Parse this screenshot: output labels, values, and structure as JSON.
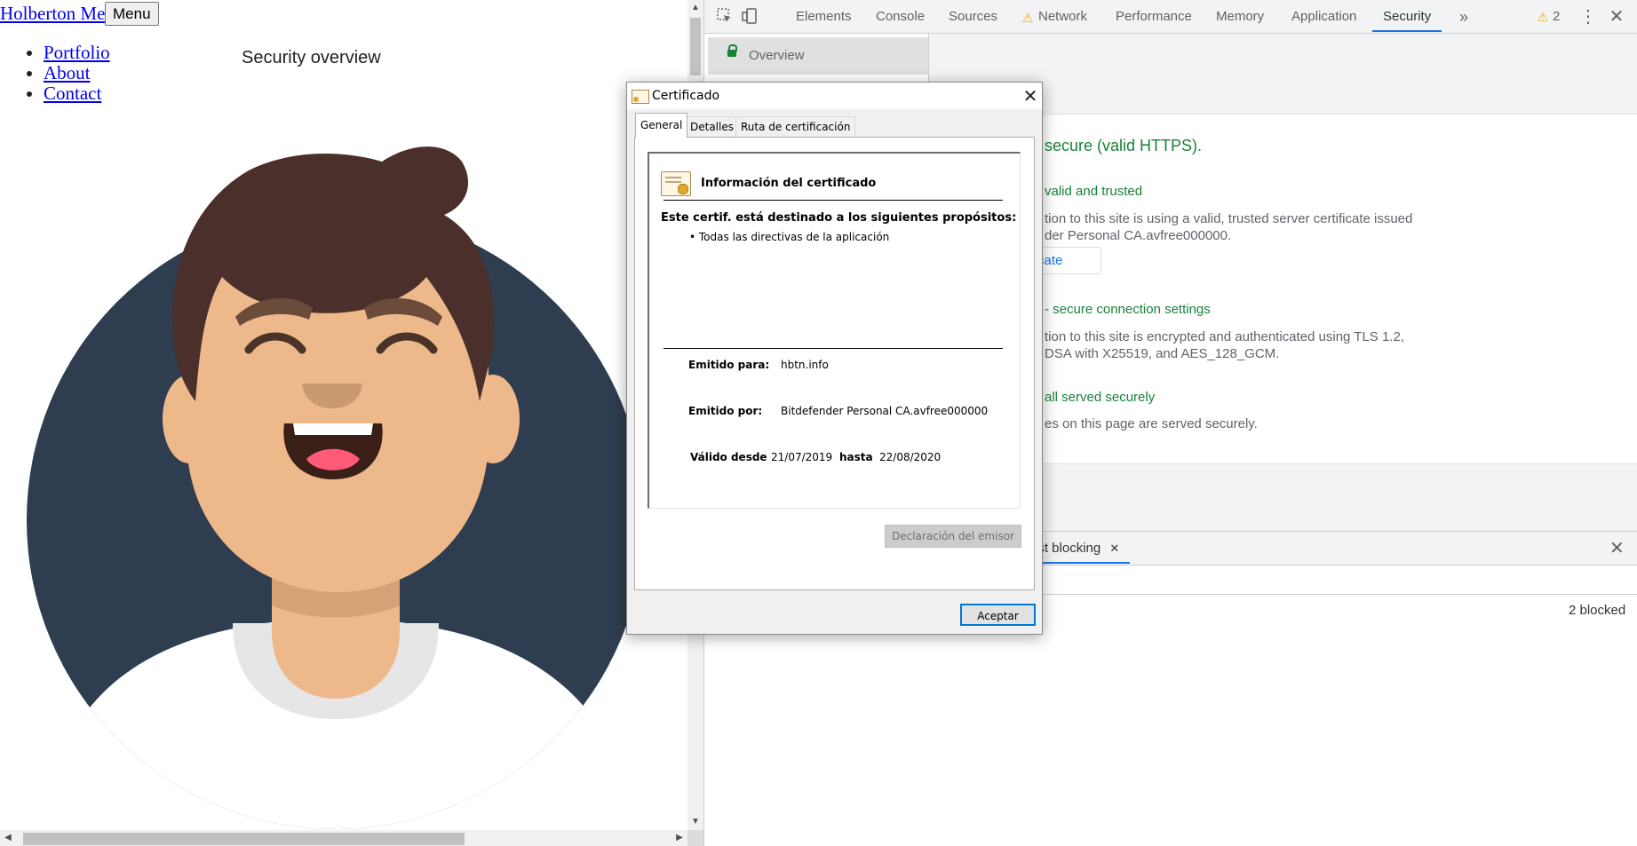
{
  "page": {
    "brand": "Holberton Me",
    "menu_button": "Menu",
    "nav": [
      "Portfolio",
      "About",
      "Contact"
    ]
  },
  "devtools": {
    "tabs": [
      "Elements",
      "Console",
      "Sources",
      "Network",
      "Performance",
      "Memory",
      "Application",
      "Security"
    ],
    "active_tab": "Security",
    "more_tabs": "»",
    "warning_count": "2",
    "sidebar_overview": "Overview",
    "main_title": "Security overview",
    "summary": "secure (valid HTTPS).",
    "cert_heading": "valid and trusted",
    "cert_text_line1": "tion to this site is using a valid, trusted server certificate issued",
    "cert_text_line2": "der Personal CA.avfree000000.",
    "view_certificate": "tificate",
    "conn_heading": "- secure connection settings",
    "conn_text_line1": "tion to this site is encrypted and authenticated using TLS 1.2,",
    "conn_text_line2": "DSA with X25519, and AES_128_GCM.",
    "resources_heading": "all served securely",
    "resources_text": "es on this page are served securely.",
    "drawer_tab": "est blocking",
    "blocked_count": "2 blocked"
  },
  "certificate": {
    "title": "Certificado",
    "tabs": [
      "General",
      "Detalles",
      "Ruta de certificación"
    ],
    "info_title": "Información del certificado",
    "purpose_heading": "Este certif. está destinado a los siguientes propósitos:",
    "purpose_item": "• Todas las directivas de la aplicación",
    "issued_to_label": "Emitido para:",
    "issued_to": "hbtn.info",
    "issued_by_label": "Emitido por:",
    "issued_by": "Bitdefender Personal CA.avfree000000",
    "valid_from_label": "Válido desde",
    "valid_from": "21/07/2019",
    "valid_to_label": "hasta",
    "valid_to": "22/08/2020",
    "issuer_statement": "Declaración del emisor",
    "accept": "Aceptar"
  },
  "colors": {
    "avatar_circle": "#2e3d4f",
    "hair": "#4a2f2b",
    "skin": "#edb98a",
    "secure_green": "#188038",
    "accent_blue": "#1a73e8"
  }
}
